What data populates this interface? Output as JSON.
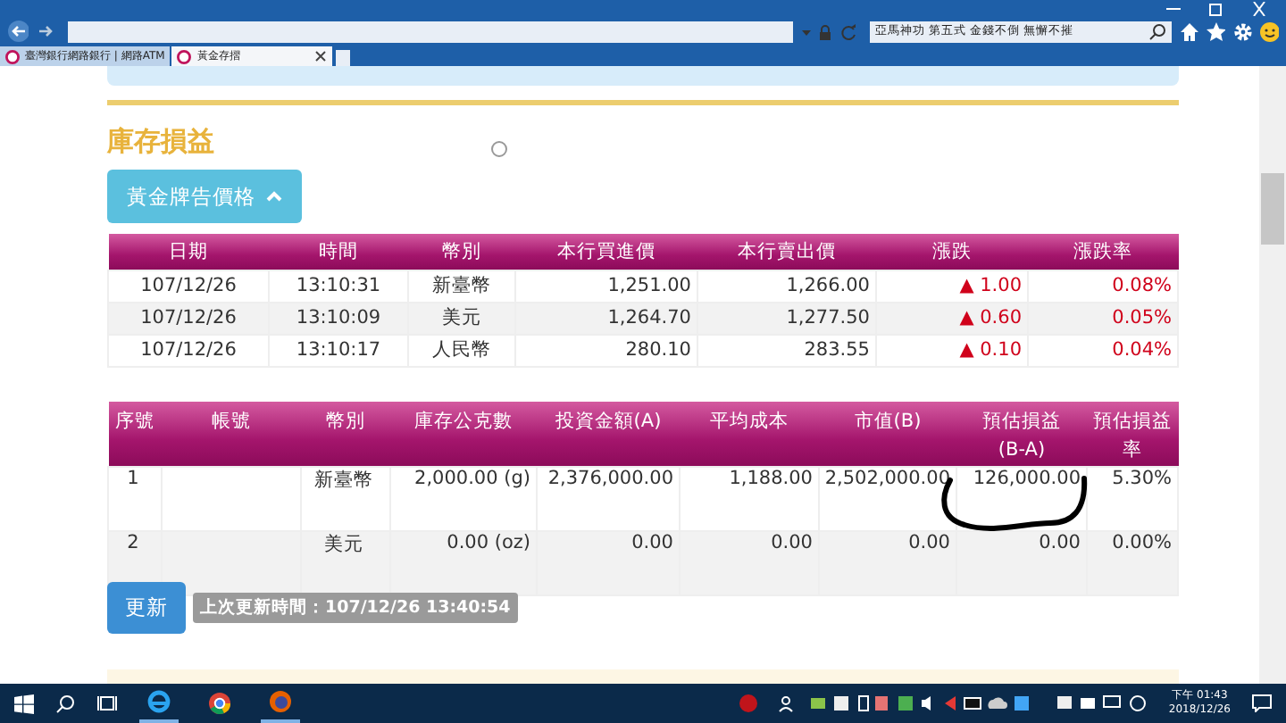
{
  "browser": {
    "search": {
      "value": "亞馬神功 第五式 金錢不倒 無懈不摧"
    },
    "tabs": [
      {
        "label": "臺灣銀行網路銀行 | 網路ATM",
        "selected": false
      },
      {
        "label": "黃金存摺",
        "selected": true
      }
    ]
  },
  "section_title": "庫存損益",
  "price_toggle": {
    "label": "黃金牌告價格",
    "expanded": true
  },
  "price_table": {
    "columns": [
      "日期",
      "時間",
      "幣別",
      "本行買進價",
      "本行賣出價",
      "漲跌",
      "漲跌率"
    ],
    "rows": [
      [
        "107/12/26",
        "13:10:31",
        "新臺幣",
        "1,251.00",
        "1,266.00",
        "▲ 1.00",
        "0.08%"
      ],
      [
        "107/12/26",
        "13:10:09",
        "美元",
        "1,264.70",
        "1,277.50",
        "▲ 0.60",
        "0.05%"
      ],
      [
        "107/12/26",
        "13:10:17",
        "人民幣",
        "280.10",
        "283.55",
        "▲ 0.10",
        "0.04%"
      ]
    ]
  },
  "holdings_table": {
    "columns": [
      "序號",
      "帳號",
      "幣別",
      "庫存公克數",
      "投資金額(A)",
      "平均成本",
      "市值(B)",
      "預估損益\n(B-A)",
      "預估損益率"
    ],
    "rows": [
      [
        "1",
        "",
        "新臺幣",
        "2,000.00 (g)",
        "2,376,000.00",
        "1,188.00",
        "2,502,000.00",
        "126,000.00",
        "5.30%"
      ],
      [
        "2",
        "",
        "美元",
        "0.00 (oz)",
        "0.00",
        "0.00",
        "0.00",
        "0.00",
        "0.00%"
      ]
    ]
  },
  "refresh_button": "更新",
  "last_updated": "上次更新時間：107/12/26 13:40:54",
  "taskbar": {
    "clock_time": "下午 01:43",
    "clock_date": "2018/12/26"
  }
}
